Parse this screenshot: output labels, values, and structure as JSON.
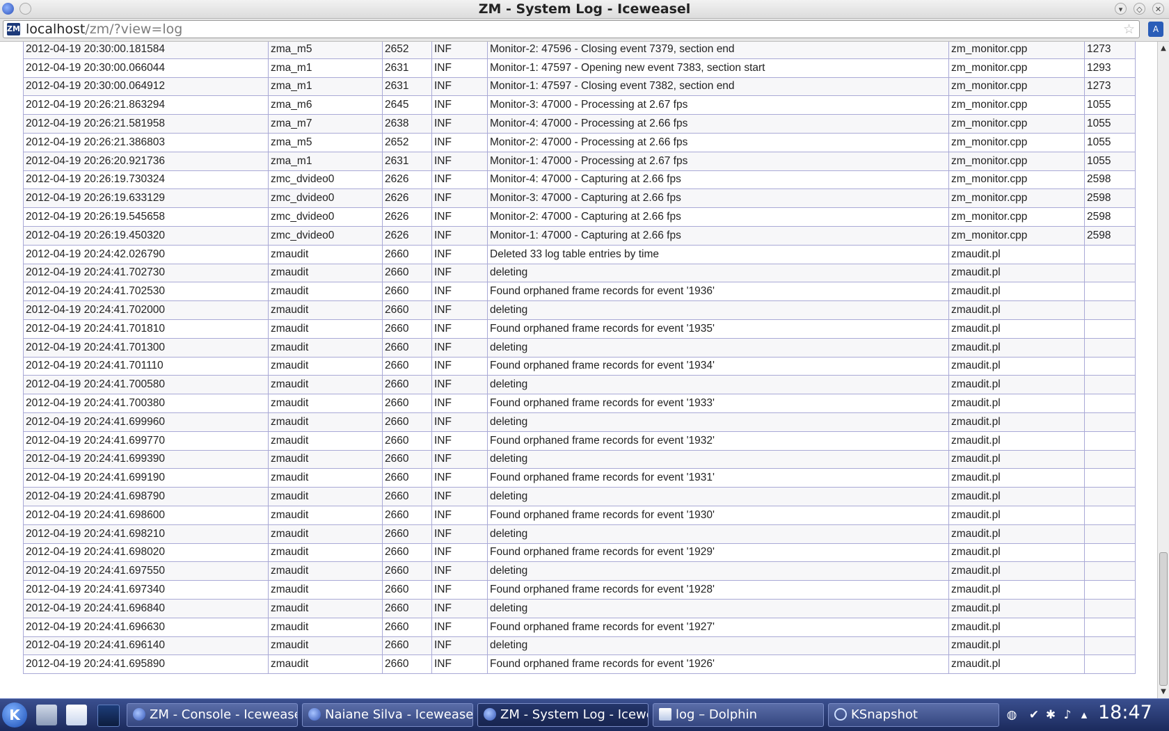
{
  "window": {
    "title": "ZM - System Log - Iceweasel"
  },
  "browser": {
    "url_host": "localhost",
    "url_path": "/zm/?view=log",
    "favicon_text": "ZM",
    "addon_icon_text": "A"
  },
  "log": {
    "rows": [
      [
        "2012-04-19 20:30:00.181584",
        "zma_m5",
        "2652",
        "INF",
        "Monitor-2: 47596 - Closing event 7379, section end",
        "zm_monitor.cpp",
        "1273"
      ],
      [
        "2012-04-19 20:30:00.066044",
        "zma_m1",
        "2631",
        "INF",
        "Monitor-1: 47597 - Opening new event 7383, section start",
        "zm_monitor.cpp",
        "1293"
      ],
      [
        "2012-04-19 20:30:00.064912",
        "zma_m1",
        "2631",
        "INF",
        "Monitor-1: 47597 - Closing event 7382, section end",
        "zm_monitor.cpp",
        "1273"
      ],
      [
        "2012-04-19 20:26:21.863294",
        "zma_m6",
        "2645",
        "INF",
        "Monitor-3: 47000 - Processing at 2.67 fps",
        "zm_monitor.cpp",
        "1055"
      ],
      [
        "2012-04-19 20:26:21.581958",
        "zma_m7",
        "2638",
        "INF",
        "Monitor-4: 47000 - Processing at 2.66 fps",
        "zm_monitor.cpp",
        "1055"
      ],
      [
        "2012-04-19 20:26:21.386803",
        "zma_m5",
        "2652",
        "INF",
        "Monitor-2: 47000 - Processing at 2.66 fps",
        "zm_monitor.cpp",
        "1055"
      ],
      [
        "2012-04-19 20:26:20.921736",
        "zma_m1",
        "2631",
        "INF",
        "Monitor-1: 47000 - Processing at 2.67 fps",
        "zm_monitor.cpp",
        "1055"
      ],
      [
        "2012-04-19 20:26:19.730324",
        "zmc_dvideo0",
        "2626",
        "INF",
        "Monitor-4: 47000 - Capturing at 2.66 fps",
        "zm_monitor.cpp",
        "2598"
      ],
      [
        "2012-04-19 20:26:19.633129",
        "zmc_dvideo0",
        "2626",
        "INF",
        "Monitor-3: 47000 - Capturing at 2.66 fps",
        "zm_monitor.cpp",
        "2598"
      ],
      [
        "2012-04-19 20:26:19.545658",
        "zmc_dvideo0",
        "2626",
        "INF",
        "Monitor-2: 47000 - Capturing at 2.66 fps",
        "zm_monitor.cpp",
        "2598"
      ],
      [
        "2012-04-19 20:26:19.450320",
        "zmc_dvideo0",
        "2626",
        "INF",
        "Monitor-1: 47000 - Capturing at 2.66 fps",
        "zm_monitor.cpp",
        "2598"
      ],
      [
        "2012-04-19 20:24:42.026790",
        "zmaudit",
        "2660",
        "INF",
        "Deleted 33 log table entries by time",
        "zmaudit.pl",
        ""
      ],
      [
        "2012-04-19 20:24:41.702730",
        "zmaudit",
        "2660",
        "INF",
        "deleting",
        "zmaudit.pl",
        ""
      ],
      [
        "2012-04-19 20:24:41.702530",
        "zmaudit",
        "2660",
        "INF",
        "Found orphaned frame records for event '1936'",
        "zmaudit.pl",
        ""
      ],
      [
        "2012-04-19 20:24:41.702000",
        "zmaudit",
        "2660",
        "INF",
        "deleting",
        "zmaudit.pl",
        ""
      ],
      [
        "2012-04-19 20:24:41.701810",
        "zmaudit",
        "2660",
        "INF",
        "Found orphaned frame records for event '1935'",
        "zmaudit.pl",
        ""
      ],
      [
        "2012-04-19 20:24:41.701300",
        "zmaudit",
        "2660",
        "INF",
        "deleting",
        "zmaudit.pl",
        ""
      ],
      [
        "2012-04-19 20:24:41.701110",
        "zmaudit",
        "2660",
        "INF",
        "Found orphaned frame records for event '1934'",
        "zmaudit.pl",
        ""
      ],
      [
        "2012-04-19 20:24:41.700580",
        "zmaudit",
        "2660",
        "INF",
        "deleting",
        "zmaudit.pl",
        ""
      ],
      [
        "2012-04-19 20:24:41.700380",
        "zmaudit",
        "2660",
        "INF",
        "Found orphaned frame records for event '1933'",
        "zmaudit.pl",
        ""
      ],
      [
        "2012-04-19 20:24:41.699960",
        "zmaudit",
        "2660",
        "INF",
        "deleting",
        "zmaudit.pl",
        ""
      ],
      [
        "2012-04-19 20:24:41.699770",
        "zmaudit",
        "2660",
        "INF",
        "Found orphaned frame records for event '1932'",
        "zmaudit.pl",
        ""
      ],
      [
        "2012-04-19 20:24:41.699390",
        "zmaudit",
        "2660",
        "INF",
        "deleting",
        "zmaudit.pl",
        ""
      ],
      [
        "2012-04-19 20:24:41.699190",
        "zmaudit",
        "2660",
        "INF",
        "Found orphaned frame records for event '1931'",
        "zmaudit.pl",
        ""
      ],
      [
        "2012-04-19 20:24:41.698790",
        "zmaudit",
        "2660",
        "INF",
        "deleting",
        "zmaudit.pl",
        ""
      ],
      [
        "2012-04-19 20:24:41.698600",
        "zmaudit",
        "2660",
        "INF",
        "Found orphaned frame records for event '1930'",
        "zmaudit.pl",
        ""
      ],
      [
        "2012-04-19 20:24:41.698210",
        "zmaudit",
        "2660",
        "INF",
        "deleting",
        "zmaudit.pl",
        ""
      ],
      [
        "2012-04-19 20:24:41.698020",
        "zmaudit",
        "2660",
        "INF",
        "Found orphaned frame records for event '1929'",
        "zmaudit.pl",
        ""
      ],
      [
        "2012-04-19 20:24:41.697550",
        "zmaudit",
        "2660",
        "INF",
        "deleting",
        "zmaudit.pl",
        ""
      ],
      [
        "2012-04-19 20:24:41.697340",
        "zmaudit",
        "2660",
        "INF",
        "Found orphaned frame records for event '1928'",
        "zmaudit.pl",
        ""
      ],
      [
        "2012-04-19 20:24:41.696840",
        "zmaudit",
        "2660",
        "INF",
        "deleting",
        "zmaudit.pl",
        ""
      ],
      [
        "2012-04-19 20:24:41.696630",
        "zmaudit",
        "2660",
        "INF",
        "Found orphaned frame records for event '1927'",
        "zmaudit.pl",
        ""
      ],
      [
        "2012-04-19 20:24:41.696140",
        "zmaudit",
        "2660",
        "INF",
        "deleting",
        "zmaudit.pl",
        ""
      ],
      [
        "2012-04-19 20:24:41.695890",
        "zmaudit",
        "2660",
        "INF",
        "Found orphaned frame records for event '1926'",
        "zmaudit.pl",
        ""
      ]
    ]
  },
  "taskbar": {
    "kmenu_text": "K",
    "tasks": [
      {
        "label": "ZM - Console - Iceweasel",
        "icon": "iceweasel-icon",
        "active": false
      },
      {
        "label": "Naiane Silva - Iceweasel",
        "icon": "iceweasel-icon",
        "active": false
      },
      {
        "label": "ZM - System Log - Iceweasel",
        "icon": "iceweasel-icon",
        "active": true
      },
      {
        "label": "log – Dolphin",
        "icon": "dolphin-icon",
        "active": false
      },
      {
        "label": "KSnapshot",
        "icon": "ksnapshot-icon",
        "active": false
      }
    ],
    "clock": "18:47"
  }
}
